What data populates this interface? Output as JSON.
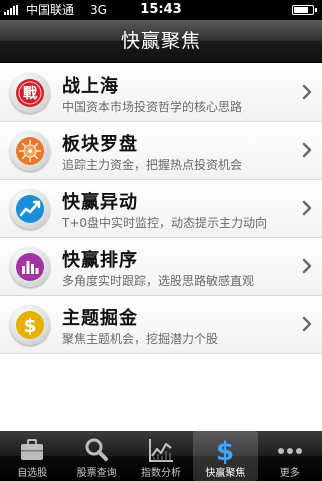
{
  "status_bar": {
    "carrier": "中国联通",
    "network": "3G",
    "time": "15:43",
    "battery_level": 0.8
  },
  "header": {
    "title": "快赢聚焦"
  },
  "menu": [
    {
      "title": "战上海",
      "desc": "中国资本市场投资哲学的核心思路",
      "icon": "battle-icon",
      "color": "#d4202a"
    },
    {
      "title": "板块罗盘",
      "desc": "追踪主力资金，把握热点投资机会",
      "icon": "compass-icon",
      "color": "#e8782a"
    },
    {
      "title": "快赢异动",
      "desc": "T+0盘中实时监控，动态提示主力动向",
      "icon": "trend-chart-icon",
      "color": "#1a8fd8"
    },
    {
      "title": "快赢排序",
      "desc": "多角度实时跟踪，选股思路敏感直观",
      "icon": "bar-chart-icon",
      "color": "#a3339e"
    },
    {
      "title": "主题掘金",
      "desc": "聚焦主题机会，挖掘潜力个股",
      "icon": "dollar-icon",
      "color": "#e6b000"
    }
  ],
  "tabs": [
    {
      "label": "自选股",
      "icon": "briefcase-icon",
      "active": false
    },
    {
      "label": "股票查询",
      "icon": "search-icon",
      "active": false
    },
    {
      "label": "指数分析",
      "icon": "line-chart-icon",
      "active": false
    },
    {
      "label": "快赢聚焦",
      "icon": "dollar-icon",
      "active": true
    },
    {
      "label": "更多",
      "icon": "more-icon",
      "active": false
    }
  ]
}
